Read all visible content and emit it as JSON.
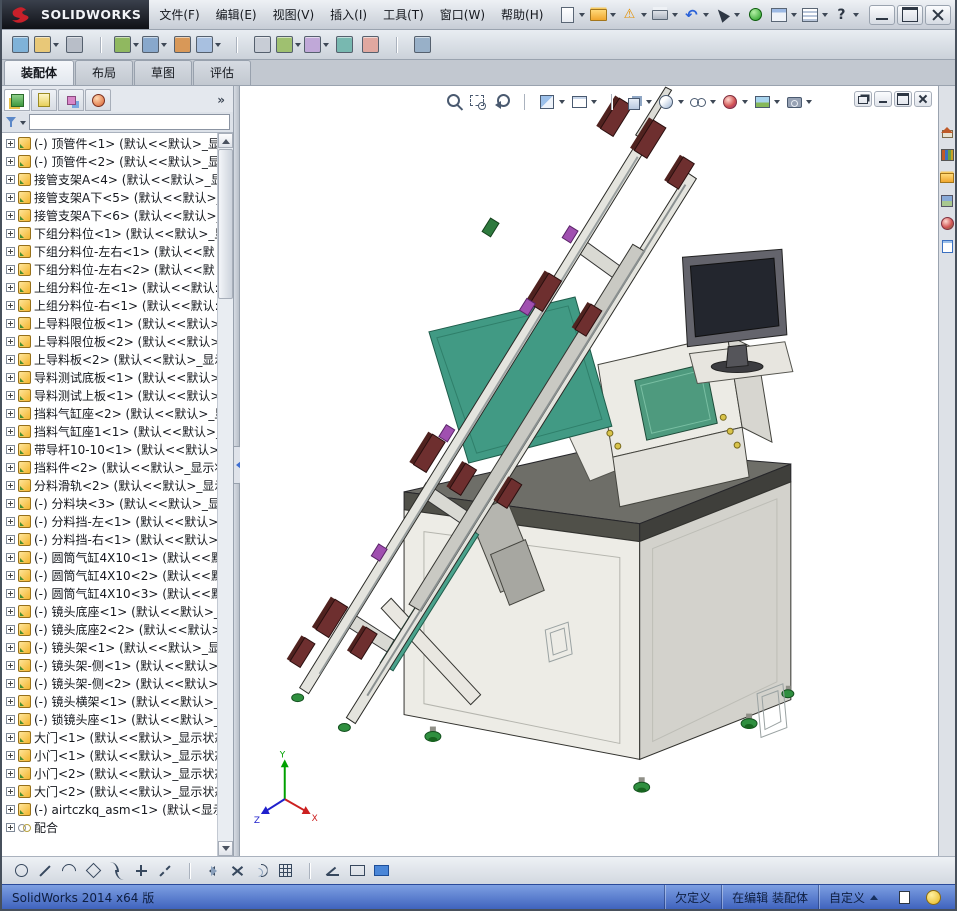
{
  "window": {
    "brand": "SOLIDWORKS"
  },
  "colors": {
    "status_blue": "#3f63be",
    "tree_icon_yellow": "#f3b52f",
    "model_teal": "#419a84",
    "clamp_maroon": "#6e2f2f"
  },
  "menubar": {
    "items": [
      "文件(F)",
      "编辑(E)",
      "视图(V)",
      "插入(I)",
      "工具(T)",
      "窗口(W)",
      "帮助(H)"
    ]
  },
  "titlebar_icons": [
    {
      "name": "new-document-icon",
      "cls": "page",
      "caret": true
    },
    {
      "name": "open-icon",
      "cls": "folder",
      "caret": true
    },
    {
      "name": "save-warning-icon",
      "cls": "warnpage",
      "glyph": "⚠",
      "caret": true
    },
    {
      "name": "print-icon",
      "cls": "printer",
      "caret": true
    },
    {
      "name": "undo-icon",
      "cls": "glyph-blue",
      "glyph": "↶",
      "caret": true
    },
    {
      "name": "select-cursor-icon",
      "cls": "cursor",
      "caret": true
    },
    {
      "name": "record-macro-icon",
      "cls": "dot-green"
    },
    {
      "name": "options-panel-icon",
      "cls": "panel-a",
      "caret": true
    },
    {
      "name": "task-list-icon",
      "cls": "panel-b",
      "caret": true
    },
    {
      "name": "help-icon",
      "cls": "glyph-dark",
      "glyph": "?",
      "caret": true
    }
  ],
  "window_buttons": [
    {
      "name": "window-minimize-icon",
      "cls": "w-min"
    },
    {
      "name": "window-maximize-icon",
      "cls": "w-max"
    },
    {
      "name": "window-close-icon",
      "cls": "w-close"
    }
  ],
  "toolbar2": {
    "icons": [
      {
        "name": "edit-component-icon",
        "cls": "sq",
        "color": "#7fb2d8"
      },
      {
        "name": "insert-components-icon",
        "cls": "sq",
        "color": "#e8c878",
        "caret": true
      },
      {
        "name": "attach-icon",
        "cls": "sq",
        "color": "#b8bec8"
      },
      {
        "name": "separator",
        "cls": "sep",
        "inter": "false"
      },
      {
        "name": "mate-icon",
        "cls": "sq",
        "color": "#90b860",
        "caret": true
      },
      {
        "name": "linear-component-pattern-icon",
        "cls": "sq",
        "color": "#88a8cc",
        "caret": true
      },
      {
        "name": "smart-fasteners-icon",
        "cls": "sq",
        "color": "#d89858"
      },
      {
        "name": "move-component-icon",
        "cls": "sq",
        "color": "#a8c0e0",
        "caret": true
      },
      {
        "name": "separator",
        "cls": "sep",
        "inter": "false"
      },
      {
        "name": "show-hidden-components-icon",
        "cls": "sq",
        "color": "#c8cdd6"
      },
      {
        "name": "assembly-features-icon",
        "cls": "sq",
        "color": "#9fc070",
        "caret": true
      },
      {
        "name": "reference-geometry-icon",
        "cls": "sq",
        "color": "#c0a8d8",
        "caret": true
      },
      {
        "name": "new-motion-study-icon",
        "cls": "sq",
        "color": "#78b8b0"
      },
      {
        "name": "exploded-view-icon",
        "cls": "sq",
        "color": "#e0a8a0"
      },
      {
        "name": "separator",
        "cls": "sep",
        "inter": "false"
      },
      {
        "name": "instant3d-icon",
        "cls": "sq",
        "color": "#98b0c8"
      }
    ]
  },
  "command_tabs": {
    "items": [
      {
        "name": "tab-assembly",
        "label": "装配体",
        "active": true
      },
      {
        "name": "tab-layout",
        "label": "布局"
      },
      {
        "name": "tab-sketch",
        "label": "草图"
      },
      {
        "name": "tab-evaluate",
        "label": "评估"
      }
    ]
  },
  "panel": {
    "tabs": [
      {
        "name": "featuremanager-tab",
        "cls": "pt-tree",
        "active": true
      },
      {
        "name": "propertymanager-tab",
        "cls": "pt-prop"
      },
      {
        "name": "configurationmanager-tab",
        "cls": "pt-config"
      },
      {
        "name": "appearances-tab",
        "cls": "pt-ball"
      }
    ],
    "more_label": "»",
    "filter": {
      "value": ""
    }
  },
  "tree": {
    "items": [
      {
        "label": "(-) 顶管件<1> (默认<<默认>_显",
        "icon": "component"
      },
      {
        "label": "(-) 顶管件<2> (默认<<默认>_显",
        "icon": "component"
      },
      {
        "label": "接管支架A<4> (默认<<默认>_显",
        "icon": "component"
      },
      {
        "label": "接管支架A下<5> (默认<<默认>_",
        "icon": "component"
      },
      {
        "label": "接管支架A下<6> (默认<<默认>_",
        "icon": "component"
      },
      {
        "label": "下组分料位<1> (默认<<默认>_显",
        "icon": "component"
      },
      {
        "label": "下组分料位-左右<1> (默认<<默",
        "icon": "component"
      },
      {
        "label": "下组分料位-左右<2> (默认<<默",
        "icon": "component"
      },
      {
        "label": "上组分料位-左<1> (默认<<默认:",
        "icon": "component"
      },
      {
        "label": "上组分料位-右<1> (默认<<默认:",
        "icon": "component"
      },
      {
        "label": "上导料限位板<1> (默认<<默认>",
        "icon": "component"
      },
      {
        "label": "上导料限位板<2> (默认<<默认>",
        "icon": "component"
      },
      {
        "label": "上导料板<2> (默认<<默认>_显示",
        "icon": "component"
      },
      {
        "label": "导料测试底板<1> (默认<<默认>",
        "icon": "component"
      },
      {
        "label": "导料测试上板<1> (默认<<默认>",
        "icon": "component"
      },
      {
        "label": "挡料气缸座<2> (默认<<默认>_显",
        "icon": "component"
      },
      {
        "label": "挡料气缸座1<1> (默认<<默认>_",
        "icon": "component"
      },
      {
        "label": "带导杆10-10<1> (默认<<默认>_",
        "icon": "component"
      },
      {
        "label": "挡料件<2> (默认<<默认>_显示状",
        "icon": "component"
      },
      {
        "label": "分料滑轨<2> (默认<<默认>_显示",
        "icon": "component"
      },
      {
        "label": "(-) 分料块<3> (默认<<默认>_显",
        "icon": "component"
      },
      {
        "label": "(-) 分料挡-左<1> (默认<<默认>_",
        "icon": "component"
      },
      {
        "label": "(-) 分料挡-右<1> (默认<<默认>",
        "icon": "component"
      },
      {
        "label": "(-) 圆筒气缸4X10<1> (默认<<默",
        "icon": "component"
      },
      {
        "label": "(-) 圆筒气缸4X10<2> (默认<<默",
        "icon": "component"
      },
      {
        "label": "(-) 圆筒气缸4X10<3> (默认<<默",
        "icon": "component"
      },
      {
        "label": "(-) 镜头底座<1> (默认<<默认>_",
        "icon": "component"
      },
      {
        "label": "(-) 镜头底座2<2> (默认<<默认>",
        "icon": "component"
      },
      {
        "label": "(-) 镜头架<1> (默认<<默认>_显",
        "icon": "component"
      },
      {
        "label": "(-) 镜头架-侧<1> (默认<<默认>",
        "icon": "component"
      },
      {
        "label": "(-) 镜头架-侧<2> (默认<<默认>_",
        "icon": "component"
      },
      {
        "label": "(-) 镜头横架<1> (默认<<默认>_!",
        "icon": "component"
      },
      {
        "label": "(-) 锁镜头座<1> (默认<<默认>_",
        "icon": "component"
      },
      {
        "label": "大门<1> (默认<<默认>_显示状态",
        "icon": "component"
      },
      {
        "label": "小门<1> (默认<<默认>_显示状态",
        "icon": "component"
      },
      {
        "label": "小门<2> (默认<<默认>_显示状态",
        "icon": "component"
      },
      {
        "label": "大门<2> (默认<<默认>_显示状态",
        "icon": "component"
      },
      {
        "label": "(-) airtczkq_asm<1> (默认<显示状",
        "icon": "component"
      },
      {
        "label": "配合",
        "icon": "mates"
      }
    ]
  },
  "viewport": {
    "hud": [
      {
        "name": "zoom-fit-icon",
        "cls": "mag"
      },
      {
        "name": "zoom-area-icon",
        "cls": "magrect"
      },
      {
        "name": "previous-view-icon",
        "cls": "magback"
      },
      {
        "name": "separator",
        "cls": "sep",
        "inter": "false"
      },
      {
        "name": "section-view-icon",
        "cls": "section",
        "caret": true
      },
      {
        "name": "annotation-view-icon",
        "cls": "annot",
        "caret": true
      },
      {
        "name": "separator",
        "cls": "sep",
        "inter": "false"
      },
      {
        "name": "view-orientation-icon",
        "cls": "cube",
        "caret": true
      },
      {
        "name": "display-style-icon",
        "cls": "dstyle",
        "caret": true
      },
      {
        "name": "hide-show-items-icon",
        "cls": "glasses",
        "caret": true
      },
      {
        "name": "edit-appearance-icon",
        "cls": "ball",
        "caret": true
      },
      {
        "name": "apply-scene-icon",
        "cls": "scene",
        "caret": true
      },
      {
        "name": "view-settings-icon",
        "cls": "camera",
        "caret": true
      }
    ],
    "controls": [
      {
        "name": "viewport-cascade-icon",
        "cls": "w-rest"
      },
      {
        "name": "viewport-minimize-icon",
        "cls": "w-min"
      },
      {
        "name": "viewport-restore-icon",
        "cls": "w-max"
      },
      {
        "name": "viewport-close-icon",
        "cls": "w-close"
      }
    ],
    "triad": {
      "x": "X",
      "y": "Y",
      "z": "Z"
    }
  },
  "task_pane": {
    "icons": [
      {
        "name": "solidworks-resources-icon",
        "cls": "tp-home"
      },
      {
        "name": "design-library-icon",
        "cls": "tp-lib"
      },
      {
        "name": "file-explorer-icon",
        "cls": "tp-folder"
      },
      {
        "name": "view-palette-icon",
        "cls": "tp-palette"
      },
      {
        "name": "appearances-icon",
        "cls": "tp-ball"
      },
      {
        "name": "custom-properties-icon",
        "cls": "tp-doc"
      }
    ]
  },
  "bottom_toolbar": {
    "icons": [
      {
        "name": "circle-tool-icon",
        "cls": "bt-circle"
      },
      {
        "name": "line-tool-icon",
        "cls": "bt-line"
      },
      {
        "name": "arc-tool-icon",
        "cls": "bt-arc"
      },
      {
        "name": "polygon-tool-icon",
        "cls": "bt-poly"
      },
      {
        "name": "spline-tool-icon",
        "cls": "bt-spline"
      },
      {
        "name": "point-tool-icon",
        "cls": "bt-point"
      },
      {
        "name": "centerline-tool-icon",
        "cls": "bt-cline"
      },
      {
        "name": "separator",
        "cls": "sep",
        "inter": "false"
      },
      {
        "name": "mirror-entities-icon",
        "cls": "bt-mirror"
      },
      {
        "name": "trim-entities-icon",
        "cls": "bt-trim"
      },
      {
        "name": "offset-entities-icon",
        "cls": "bt-offset"
      },
      {
        "name": "linear-pattern-icon",
        "cls": "bt-grid"
      },
      {
        "name": "separator",
        "cls": "sep",
        "inter": "false"
      },
      {
        "name": "angle-snap-icon",
        "cls": "bt-angle"
      },
      {
        "name": "rectangle-tool-icon",
        "cls": "bt-rect"
      },
      {
        "name": "viewport-pane-icon",
        "cls": "bt-bluerect"
      }
    ]
  },
  "statusbar": {
    "app": "SolidWorks 2014 x64 版",
    "state": "欠定义",
    "editing": "在编辑 装配体",
    "custom": "自定义",
    "icons": [
      {
        "name": "status-doc-icon",
        "cls": "st-doc"
      },
      {
        "name": "quick-tips-icon",
        "cls": "st-tip"
      }
    ]
  }
}
